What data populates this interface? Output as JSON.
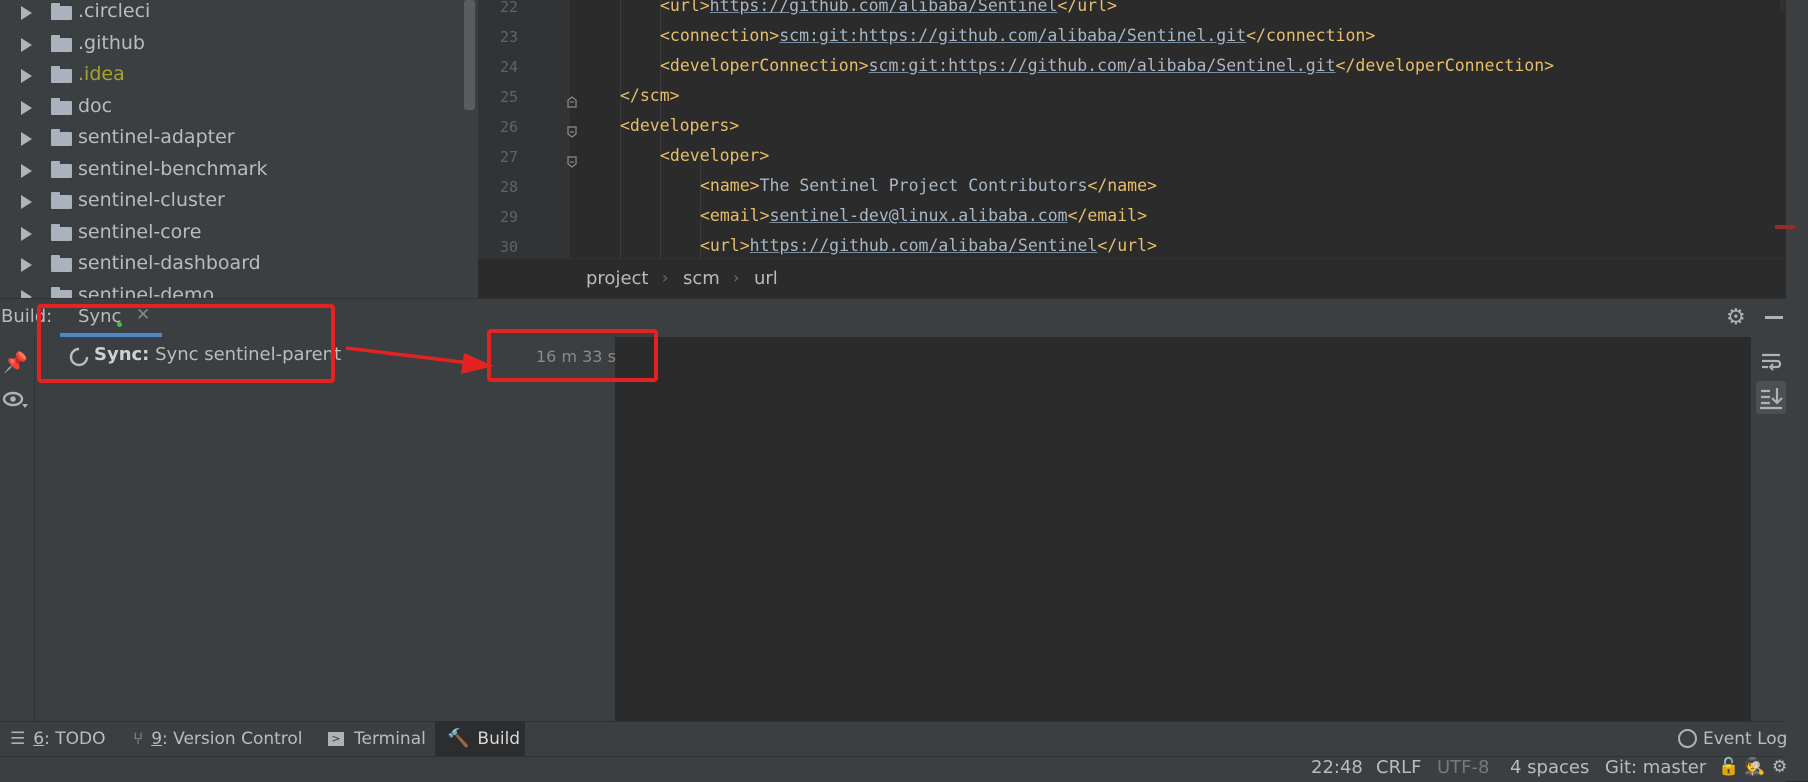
{
  "project_tree": {
    "items": [
      {
        "label": ".circleci",
        "excluded": false
      },
      {
        "label": ".github",
        "excluded": false
      },
      {
        "label": ".idea",
        "excluded": true
      },
      {
        "label": "doc",
        "excluded": false
      },
      {
        "label": "sentinel-adapter",
        "excluded": false
      },
      {
        "label": "sentinel-benchmark",
        "excluded": false
      },
      {
        "label": "sentinel-cluster",
        "excluded": false
      },
      {
        "label": "sentinel-core",
        "excluded": false
      },
      {
        "label": "sentinel-dashboard",
        "excluded": false
      },
      {
        "label": "sentinel-demo",
        "excluded": false
      }
    ]
  },
  "editor": {
    "lines": [
      {
        "num": "22",
        "open": "<url>",
        "value": "https://github.com/alibaba/Sentinel",
        "close": "</url>",
        "link": true
      },
      {
        "num": "23",
        "open": "<connection>",
        "value": "scm:git:https://github.com/alibaba/Sentinel.git",
        "close": "</connection>",
        "link": true
      },
      {
        "num": "24",
        "open": "<developerConnection>",
        "value": "scm:git:https://github.com/alibaba/Sentinel.git",
        "close": "</developerConnection>",
        "link": true
      },
      {
        "num": "25",
        "open": "</scm>",
        "value": "",
        "close": "",
        "link": false
      },
      {
        "num": "26",
        "open": "<developers>",
        "value": "",
        "close": "",
        "link": false
      },
      {
        "num": "27",
        "open": "<developer>",
        "value": "",
        "close": "",
        "link": false
      },
      {
        "num": "28",
        "open": "<name>",
        "value": "The Sentinel Project Contributors",
        "close": "</name>",
        "link": false
      },
      {
        "num": "29",
        "open": "<email>",
        "value": "sentinel-dev@linux.alibaba.com",
        "close": "</email>",
        "link": true
      },
      {
        "num": "30",
        "open": "<url>",
        "value": "https://github.com/alibaba/Sentinel",
        "close": "</url>",
        "link": true
      }
    ]
  },
  "breadcrumb": [
    "project",
    "scm",
    "url"
  ],
  "build": {
    "title": "Build:",
    "tab_label": "Sync",
    "sync_label": "Sync:",
    "sync_text": "Sync sentinel-parent",
    "duration": "16 m 33 s"
  },
  "tool_strip": {
    "todo_num": "6",
    "todo_label": ": TODO",
    "vcs_num": "9",
    "vcs_label": ": Version Control",
    "terminal": "Terminal",
    "build": "Build",
    "event_log": "Event Log"
  },
  "status_bar": {
    "position": "22:48",
    "line_sep": "CRLF",
    "encoding": "UTF-8",
    "indent": "4 spaces",
    "git": "Git: master"
  },
  "colors": {
    "accent_tab": "#4a88c7",
    "callout": "#e52222",
    "excluded_folder": "#a5a52e",
    "xml_tag": "#e8bf6a"
  }
}
